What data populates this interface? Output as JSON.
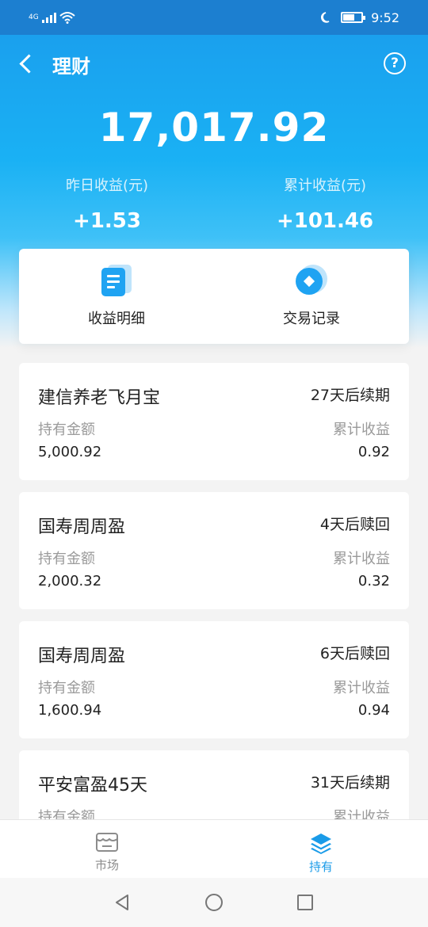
{
  "status_bar": {
    "network": "4G",
    "time": "9:52",
    "battery_level": 0.65
  },
  "nav": {
    "title": "理财",
    "help_glyph": "?"
  },
  "summary": {
    "total": "17,017.92",
    "yesterday_label": "昨日收益(元)",
    "yesterday_value": "+1.53",
    "cumulative_label": "累计收益(元)",
    "cumulative_value": "+101.46"
  },
  "actions": [
    {
      "label": "收益明细",
      "icon": "document-icon"
    },
    {
      "label": "交易记录",
      "icon": "coin-icon"
    }
  ],
  "holdings": [
    {
      "name": "建信养老飞月宝",
      "term": "27天后续期",
      "amount_label": "持有金额",
      "amount": "5,000.92",
      "income_label": "累计收益",
      "income": "0.92"
    },
    {
      "name": "国寿周周盈",
      "term": "4天后赎回",
      "amount_label": "持有金额",
      "amount": "2,000.32",
      "income_label": "累计收益",
      "income": "0.32"
    },
    {
      "name": "国寿周周盈",
      "term": "6天后赎回",
      "amount_label": "持有金额",
      "amount": "1,600.94",
      "income_label": "累计收益",
      "income": "0.94"
    },
    {
      "name": "平安富盈45天",
      "term": "31天后续期",
      "amount_label": "持有金额",
      "amount": "",
      "income_label": "累计收益",
      "income": ""
    }
  ],
  "tabs": [
    {
      "label": "市场",
      "icon": "market-icon",
      "active": false
    },
    {
      "label": "持有",
      "icon": "holdings-layers-icon",
      "active": true
    }
  ],
  "colors": {
    "brand_blue": "#1aa0ee",
    "status_bar": "#1c7fd0",
    "active_tab": "#1a9be8"
  }
}
